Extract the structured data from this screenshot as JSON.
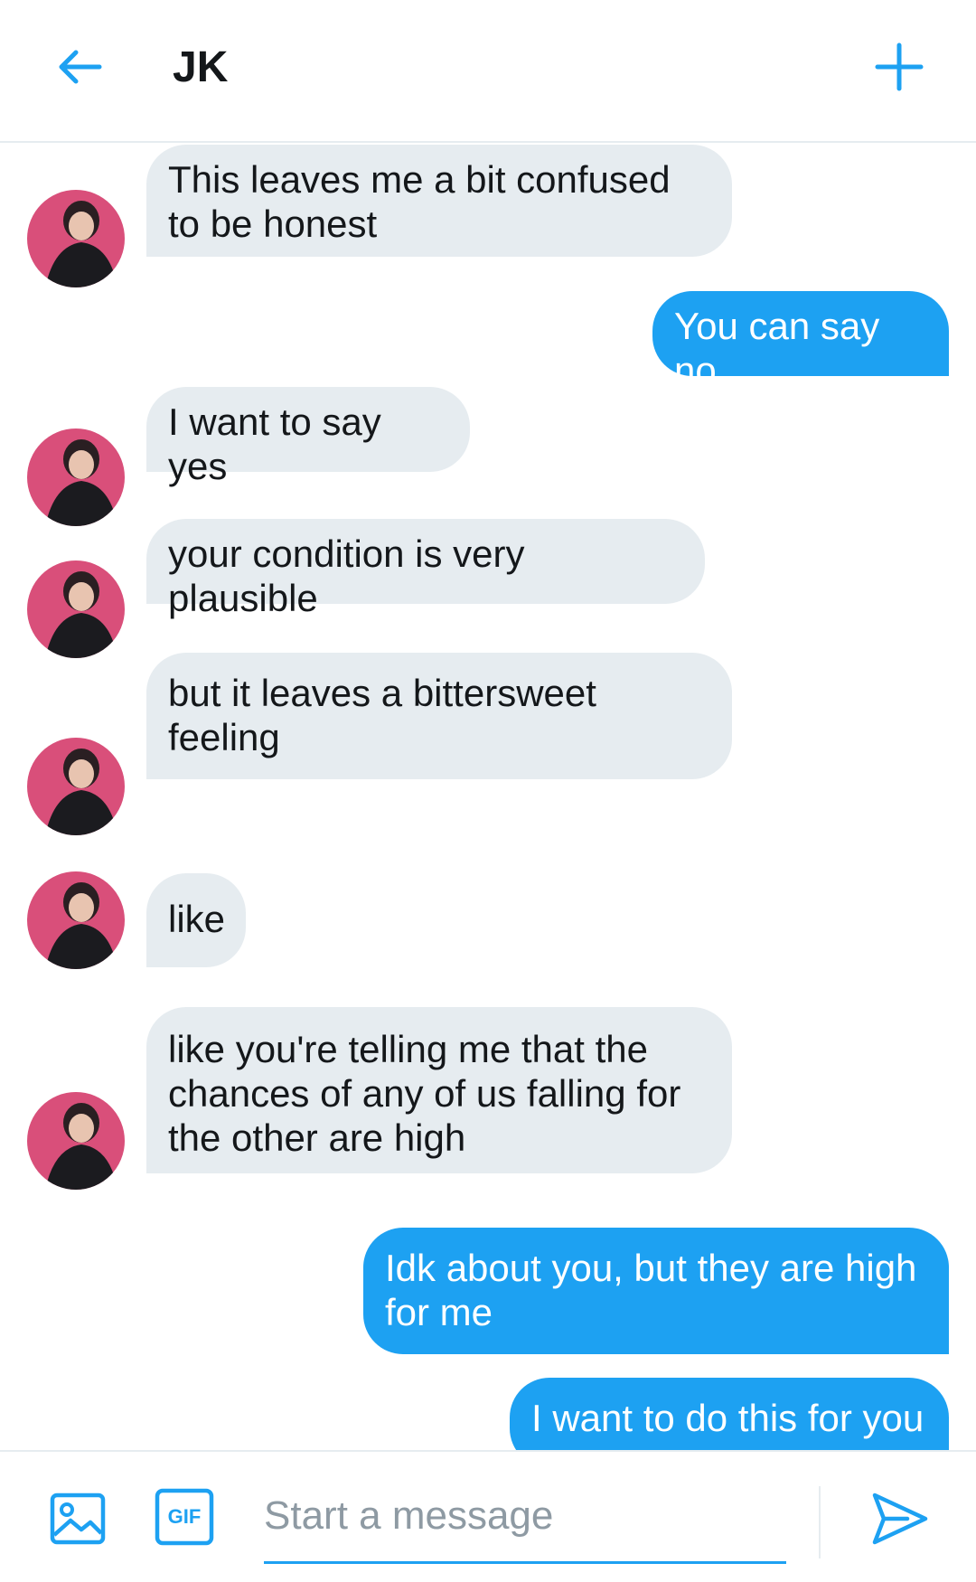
{
  "header": {
    "title": "JK",
    "back_icon": "arrow-left-icon",
    "new_icon": "plus-icon"
  },
  "colors": {
    "accent": "#1da1f2",
    "incoming_bubble": "#e6ecf0",
    "avatar_background": "#d94f7a"
  },
  "messages": [
    {
      "direction": "incoming",
      "text": "This leaves me a bit confused\nto be honest"
    },
    {
      "direction": "outgoing",
      "text": "You can say no"
    },
    {
      "direction": "incoming",
      "text": "I want to say yes"
    },
    {
      "direction": "incoming",
      "text": "your condition is very plausible"
    },
    {
      "direction": "incoming",
      "text": "but it leaves a bittersweet\nfeeling"
    },
    {
      "direction": "incoming",
      "text": "like"
    },
    {
      "direction": "incoming",
      "text": "like you're telling me that the\nchances of any of us falling for\nthe other are high"
    },
    {
      "direction": "outgoing",
      "text": "Idk about you, but they are high\nfor me"
    },
    {
      "direction": "outgoing",
      "text": "I want to do this for you"
    }
  ],
  "composer": {
    "placeholder": "Start a message",
    "value": "",
    "image_icon": "image-icon",
    "gif_label": "GIF",
    "send_icon": "send-icon"
  }
}
